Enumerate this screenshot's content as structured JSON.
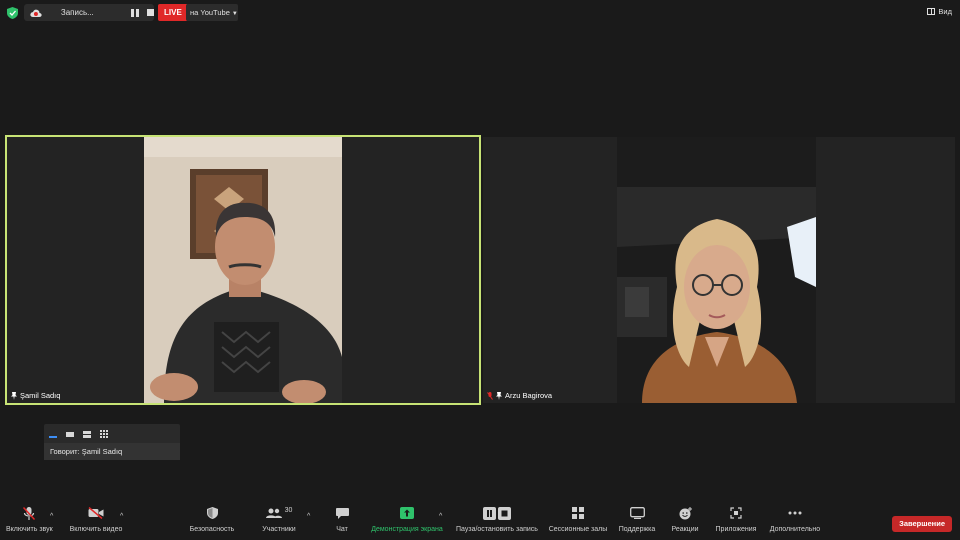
{
  "topbar": {
    "recording_label": "Запись...",
    "live_label": "LIVE",
    "stream_target": "на YouTube",
    "view_label": "Вид"
  },
  "participants": [
    {
      "name": "Şamil Sadıq"
    },
    {
      "name": "Arzu Bagirova"
    }
  ],
  "speaker_panel": {
    "speaking_text": "Говорит: Şamil Sadıq"
  },
  "toolbar": {
    "audio_label": "Включить звук",
    "video_label": "Включить видео",
    "security_label": "Безопасность",
    "participants_label": "Участники",
    "participants_count": "30",
    "chat_label": "Чат",
    "share_label": "Демонстрация экрана",
    "record_label": "Пауза/остановить запись",
    "breakout_label": "Сессионные залы",
    "support_label": "Поддержка",
    "reactions_label": "Реакции",
    "apps_label": "Приложения",
    "more_label": "Дополнительно",
    "end_label": "Завершение"
  },
  "colors": {
    "active_speaker_border": "#c7e375",
    "live_red": "#e02828",
    "share_green": "#2fc26b",
    "end_red": "#c62828"
  }
}
